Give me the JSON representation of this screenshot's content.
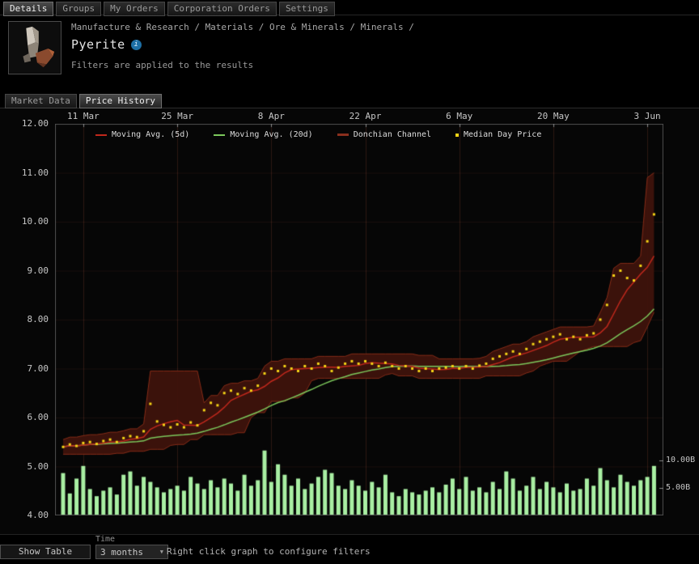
{
  "window": {
    "tabs": [
      {
        "label": "Details",
        "active": true
      },
      {
        "label": "Groups",
        "active": false
      },
      {
        "label": "My Orders",
        "active": false
      },
      {
        "label": "Corporation Orders",
        "active": false
      },
      {
        "label": "Settings",
        "active": false
      }
    ],
    "breadcrumb": "Manufacture & Research / Materials / Ore & Minerals / Minerals /",
    "title": "Pyerite",
    "info_glyph": "i",
    "filters_note": "Filters are applied to the results",
    "subtabs": [
      {
        "label": "Market Data",
        "active": false
      },
      {
        "label": "Price History",
        "active": true
      }
    ]
  },
  "footer": {
    "show_table_label": "Show Table",
    "time_label": "Time",
    "time_value": "3 months",
    "hint": "Right click graph to configure filters"
  },
  "colors": {
    "volume_bar": "#a9efa3",
    "median_dot": "#f5d516",
    "ma5": "#c0281c",
    "ma20": "#7cc85c",
    "donchian_fill": "rgba(64,20,12,0.92)",
    "donchian_edge": "rgba(145,48,26,0.9)",
    "grid_v": "rgba(150,75,55,0.28)",
    "grid_h": "rgba(150,75,55,0.14)",
    "plot_border": "#4f4f4f",
    "axis_text": "#c6c6c6",
    "accent_blue": "#1e6fa5"
  },
  "chart_data": {
    "type": "line",
    "title": "Price History",
    "legend": [
      {
        "label": "Moving Avg. (5d)",
        "color": "#c0281c",
        "type": "line"
      },
      {
        "label": "Moving Avg. (20d)",
        "color": "#7cc85c",
        "type": "line"
      },
      {
        "label": "Donchian Channel",
        "color": "#8a2f1d",
        "type": "band"
      },
      {
        "label": "Median Day Price",
        "color": "#f5d516",
        "type": "dot"
      }
    ],
    "y_axis": {
      "min": 4,
      "max": 12,
      "ticks": [
        {
          "v": 4,
          "label": "4.00"
        },
        {
          "v": 5,
          "label": "5.00"
        },
        {
          "v": 6,
          "label": "6.00"
        },
        {
          "v": 7,
          "label": "7.00"
        },
        {
          "v": 8,
          "label": "8.00"
        },
        {
          "v": 9,
          "label": "9.00"
        },
        {
          "v": 10,
          "label": "10.00"
        },
        {
          "v": 11,
          "label": "11.00"
        },
        {
          "v": 12,
          "label": "12.00"
        }
      ]
    },
    "y2_axis": {
      "unit": "B",
      "ticks": [
        {
          "v": 5,
          "label": "5.00B"
        },
        {
          "v": 10,
          "label": "10.00B"
        }
      ]
    },
    "x_axis": {
      "total_days": 89,
      "ticks": [
        {
          "day": 3,
          "label": "11 Mar"
        },
        {
          "day": 17,
          "label": "25 Mar"
        },
        {
          "day": 31,
          "label": "8 Apr"
        },
        {
          "day": 45,
          "label": "22 Apr"
        },
        {
          "day": 59,
          "label": "6 May"
        },
        {
          "day": 73,
          "label": "20 May"
        },
        {
          "day": 87,
          "label": "3 Jun"
        }
      ]
    },
    "derived": {
      "ma_windows": [
        5,
        20
      ],
      "donchian_window": 8
    },
    "series": {
      "median": [
        5.4,
        5.45,
        5.42,
        5.48,
        5.5,
        5.46,
        5.52,
        5.55,
        5.5,
        5.58,
        5.62,
        5.6,
        5.72,
        6.28,
        5.92,
        5.85,
        5.8,
        5.86,
        5.8,
        5.9,
        5.84,
        6.15,
        6.3,
        6.25,
        6.5,
        6.55,
        6.48,
        6.6,
        6.55,
        6.65,
        6.9,
        7.0,
        6.95,
        7.05,
        7.0,
        6.95,
        7.05,
        7.0,
        7.1,
        7.05,
        6.95,
        7.02,
        7.1,
        7.15,
        7.1,
        7.15,
        7.1,
        7.05,
        7.12,
        7.05,
        7.0,
        7.05,
        7.0,
        6.95,
        7.0,
        6.95,
        7.0,
        7.02,
        7.05,
        7.0,
        7.05,
        7.0,
        7.06,
        7.1,
        7.2,
        7.25,
        7.3,
        7.35,
        7.3,
        7.4,
        7.5,
        7.55,
        7.6,
        7.65,
        7.7,
        7.6,
        7.65,
        7.6,
        7.68,
        7.72,
        8.0,
        8.3,
        8.9,
        9.0,
        8.85,
        8.8,
        9.1,
        9.6,
        10.15
      ],
      "high": [
        5.55,
        5.6,
        5.57,
        5.63,
        5.65,
        5.61,
        5.67,
        5.7,
        5.65,
        5.73,
        5.77,
        5.75,
        5.87,
        6.95,
        6.07,
        6.0,
        5.95,
        6.01,
        5.95,
        6.05,
        5.99,
        6.3,
        6.45,
        6.4,
        6.65,
        6.7,
        6.63,
        6.75,
        6.7,
        6.8,
        7.05,
        7.15,
        7.1,
        7.2,
        7.15,
        7.1,
        7.2,
        7.15,
        7.25,
        7.2,
        7.1,
        7.17,
        7.25,
        7.3,
        7.25,
        7.3,
        7.25,
        7.2,
        7.27,
        7.2,
        7.15,
        7.2,
        7.15,
        7.1,
        7.15,
        7.1,
        7.15,
        7.17,
        7.2,
        7.15,
        7.2,
        7.15,
        7.21,
        7.25,
        7.35,
        7.4,
        7.45,
        7.5,
        7.45,
        7.55,
        7.65,
        7.7,
        7.75,
        7.8,
        7.85,
        7.75,
        7.8,
        7.75,
        7.83,
        7.87,
        8.15,
        8.45,
        9.05,
        9.15,
        9.0,
        8.95,
        9.3,
        10.9,
        11.0
      ],
      "low": [
        5.25,
        5.3,
        5.27,
        5.33,
        5.35,
        5.31,
        5.37,
        5.4,
        5.35,
        5.43,
        5.47,
        5.45,
        5.57,
        5.55,
        5.77,
        5.7,
        5.65,
        5.71,
        5.65,
        5.75,
        5.69,
        6.0,
        6.15,
        6.1,
        6.35,
        6.4,
        6.33,
        6.45,
        6.4,
        6.5,
        6.75,
        6.85,
        6.8,
        6.9,
        6.85,
        6.8,
        6.9,
        6.85,
        6.95,
        6.9,
        6.8,
        6.87,
        6.95,
        7.0,
        6.95,
        7.0,
        6.95,
        6.9,
        6.97,
        6.9,
        6.85,
        6.9,
        6.85,
        6.8,
        6.85,
        6.8,
        6.85,
        6.87,
        6.9,
        6.85,
        6.9,
        6.85,
        6.91,
        6.95,
        7.05,
        7.1,
        7.15,
        7.2,
        7.15,
        7.25,
        7.35,
        7.4,
        7.45,
        7.5,
        7.55,
        7.45,
        7.5,
        7.45,
        7.53,
        7.57,
        7.85,
        8.15,
        8.75,
        8.85,
        8.7,
        8.65,
        8.95,
        9.45,
        8.2
      ],
      "volume_b": [
        7.7,
        4.0,
        6.7,
        9.0,
        4.8,
        3.5,
        4.5,
        5.1,
        3.8,
        7.4,
        8.0,
        5.4,
        7.0,
        6.1,
        5.1,
        4.2,
        4.8,
        5.4,
        4.5,
        7.0,
        5.8,
        4.8,
        6.4,
        5.1,
        6.7,
        5.8,
        4.5,
        7.4,
        5.4,
        6.4,
        11.8,
        6.1,
        9.3,
        7.4,
        5.4,
        6.7,
        4.8,
        5.8,
        7.0,
        8.3,
        7.7,
        5.4,
        4.8,
        6.4,
        5.4,
        4.5,
        6.1,
        5.1,
        7.4,
        4.2,
        3.5,
        4.8,
        4.2,
        3.8,
        4.5,
        5.1,
        4.2,
        5.6,
        6.7,
        4.8,
        7.0,
        4.5,
        5.1,
        4.2,
        6.1,
        4.8,
        8.0,
        6.7,
        4.5,
        5.4,
        7.0,
        4.8,
        6.1,
        5.1,
        4.2,
        5.8,
        4.5,
        4.8,
        6.7,
        5.4,
        8.6,
        6.4,
        5.1,
        7.4,
        6.1,
        5.4,
        6.4,
        7.0,
        9.0
      ]
    }
  }
}
